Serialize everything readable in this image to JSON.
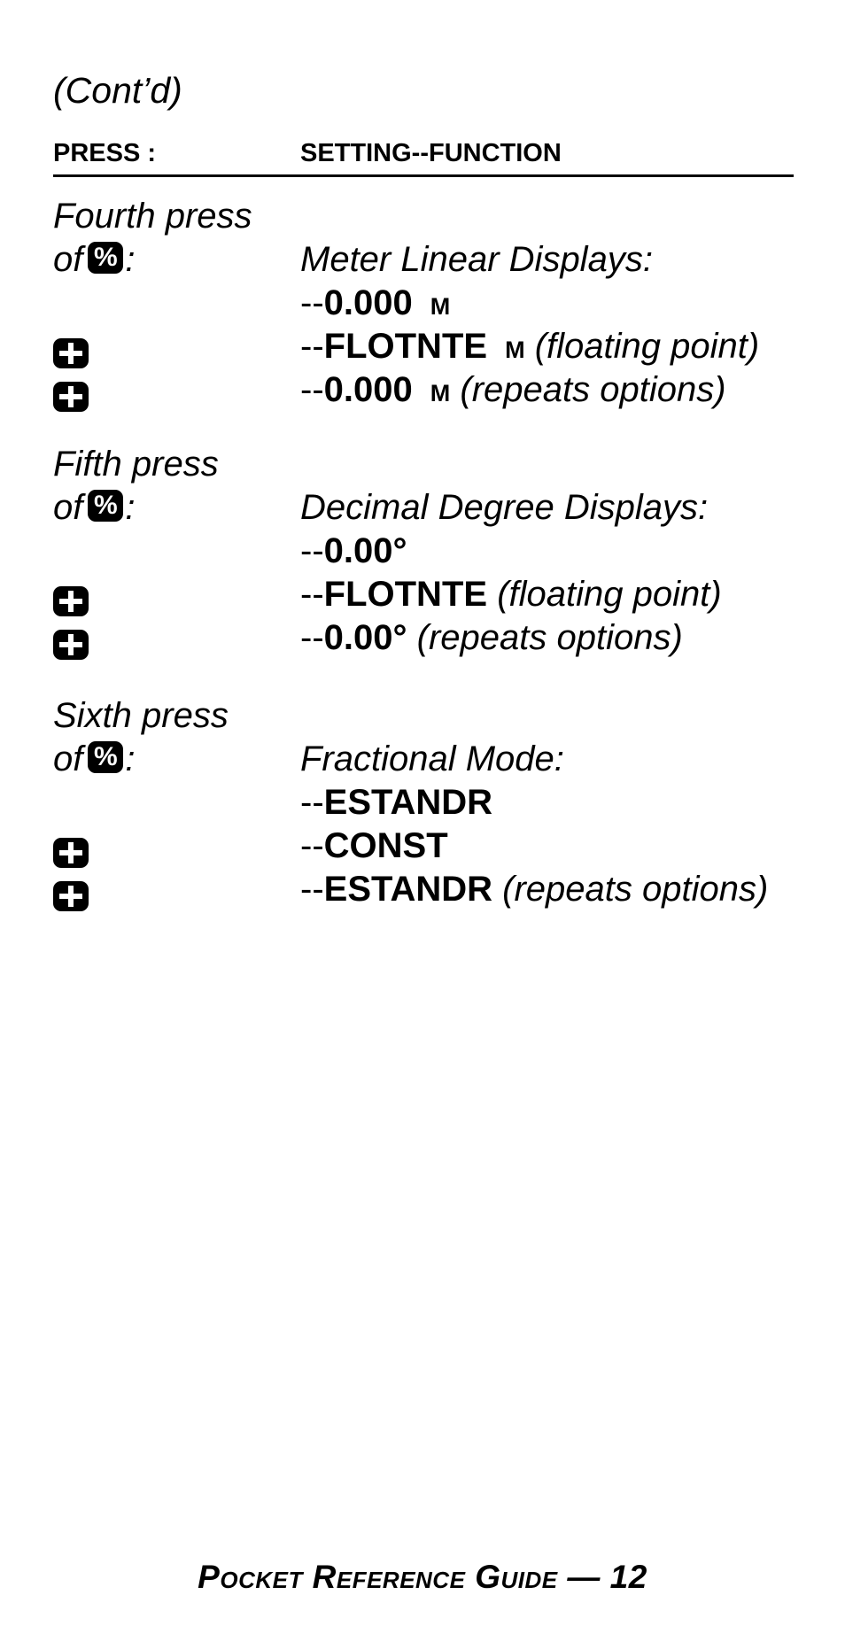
{
  "continued_label": "(Cont’d)",
  "table_header": {
    "press": "PRESS :",
    "setting": "SETTING--FUNCTION"
  },
  "sections": [
    {
      "press_line1": "Fourth press",
      "press_line2_prefix": "of",
      "press_key": "%",
      "press_line2_suffix": ":",
      "title": "Meter Linear Displays:",
      "options": [
        {
          "key": "",
          "value": "0.000",
          "unit": "M",
          "note": ""
        },
        {
          "key": "plus-key",
          "value": "FLOTNTE",
          "unit": "M",
          "note": "(floating point)"
        },
        {
          "key": "plus-key",
          "value": "0.000",
          "unit": "M",
          "note": "(repeats options)"
        }
      ]
    },
    {
      "press_line1": "Fifth press",
      "press_line2_prefix": "of",
      "press_key": "%",
      "press_line2_suffix": ":",
      "title": "Decimal Degree Displays:",
      "options": [
        {
          "key": "",
          "value": "0.00°",
          "unit": "",
          "note": ""
        },
        {
          "key": "plus-key",
          "value": "FLOTNTE",
          "unit": "",
          "note": "(floating point)"
        },
        {
          "key": "plus-key",
          "value": "0.00°",
          "unit": "",
          "note": "(repeats options)"
        }
      ]
    },
    {
      "press_line1": "Sixth press",
      "press_line2_prefix": "of",
      "press_key": "%",
      "press_line2_suffix": ":",
      "title": "Fractional Mode:",
      "options": [
        {
          "key": "",
          "value": "ESTANDR",
          "unit": "",
          "note": ""
        },
        {
          "key": "plus-key",
          "value": "CONST",
          "unit": "",
          "note": ""
        },
        {
          "key": "plus-key",
          "value": "ESTANDR",
          "unit": "",
          "note": "(repeats options)"
        }
      ]
    }
  ],
  "dash_prefix": "--",
  "footer": "Pocket Reference Guide — 12"
}
